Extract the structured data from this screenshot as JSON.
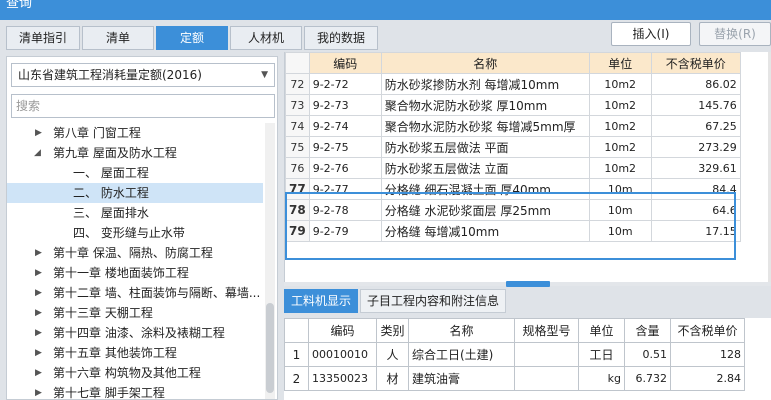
{
  "window": {
    "title": "查询"
  },
  "tabs": [
    "清单指引",
    "清单",
    "定额",
    "人材机",
    "我的数据"
  ],
  "buttons": {
    "insert": "插入(I)",
    "replace": "替换(R)"
  },
  "quota_library": {
    "selected": "山东省建筑工程消耗量定额(2016)"
  },
  "search": {
    "placeholder": "搜索"
  },
  "tree": [
    {
      "label": "第八章 门窗工程",
      "level": 1,
      "expanded": false
    },
    {
      "label": "第九章 屋面及防水工程",
      "level": 1,
      "expanded": true
    },
    {
      "label": "一、 屋面工程",
      "level": 2
    },
    {
      "label": "二、 防水工程",
      "level": 2,
      "selected": true
    },
    {
      "label": "三、 屋面排水",
      "level": 2
    },
    {
      "label": "四、 变形缝与止水带",
      "level": 2
    },
    {
      "label": "第十章 保温、隔热、防腐工程",
      "level": 1
    },
    {
      "label": "第十一章 楼地面装饰工程",
      "level": 1
    },
    {
      "label": "第十二章 墙、柱面装饰与隔断、幕墙...",
      "level": 1
    },
    {
      "label": "第十三章 天棚工程",
      "level": 1
    },
    {
      "label": "第十四章 油漆、涂料及裱糊工程",
      "level": 1
    },
    {
      "label": "第十五章 其他装饰工程",
      "level": 1
    },
    {
      "label": "第十六章 构筑物及其他工程",
      "level": 1
    },
    {
      "label": "第十七章 脚手架工程",
      "level": 1
    }
  ],
  "quota_table": {
    "headers": [
      "编码",
      "名称",
      "单位",
      "不含税单价"
    ],
    "rows": [
      {
        "num": "72",
        "code": "9-2-72",
        "name": "防水砂浆掺防水剂 每增减10mm",
        "unit": "10m2",
        "price": "86.02"
      },
      {
        "num": "73",
        "code": "9-2-73",
        "name": "聚合物水泥防水砂浆 厚10mm",
        "unit": "10m2",
        "price": "145.76"
      },
      {
        "num": "74",
        "code": "9-2-74",
        "name": "聚合物水泥防水砂浆 每增减5mm厚",
        "unit": "10m2",
        "price": "67.25"
      },
      {
        "num": "75",
        "code": "9-2-75",
        "name": "防水砂浆五层做法 平面",
        "unit": "10m2",
        "price": "273.29"
      },
      {
        "num": "76",
        "code": "9-2-76",
        "name": "防水砂浆五层做法 立面",
        "unit": "10m2",
        "price": "329.61"
      },
      {
        "num": "77",
        "code": "9-2-77",
        "name": "分格缝 细石混凝土面 厚40mm",
        "unit": "10m",
        "price": "84.4"
      },
      {
        "num": "78",
        "code": "9-2-78",
        "name": "分格缝 水泥砂浆面层 厚25mm",
        "unit": "10m",
        "price": "64.6"
      },
      {
        "num": "79",
        "code": "9-2-79",
        "name": "分格缝 每增减10mm",
        "unit": "10m",
        "price": "17.15"
      }
    ]
  },
  "bottom_tabs": [
    "工料机显示",
    "子目工程内容和附注信息"
  ],
  "resource_table": {
    "headers": [
      "编码",
      "类别",
      "名称",
      "规格型号",
      "单位",
      "含量",
      "不含税单价"
    ],
    "rows": [
      {
        "num": "1",
        "code": "00010010",
        "type": "人",
        "name": "综合工日(土建)",
        "spec": "",
        "unit": "工日",
        "qty": "0.51",
        "price": "128"
      },
      {
        "num": "2",
        "code": "13350023",
        "type": "材",
        "name": "建筑油膏",
        "spec": "",
        "unit": "kg",
        "qty": "6.732",
        "price": "2.84"
      }
    ]
  },
  "colors": {
    "accent": "#3c8fd9",
    "header_bg": "#fbe8cb",
    "selection": "#cfe4f7"
  }
}
